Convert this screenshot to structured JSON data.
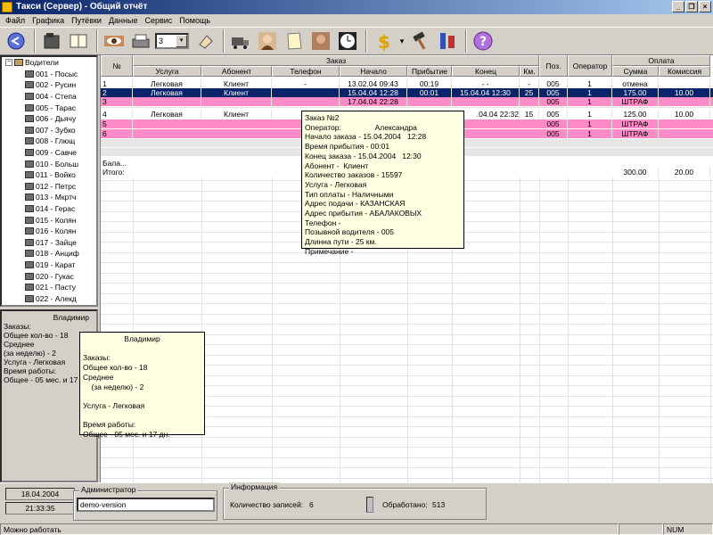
{
  "window": {
    "title": "Такси (Сервер) - Общий отчёт",
    "min": "_",
    "restore": "❐",
    "close": "×"
  },
  "menu": [
    "Файл",
    "Графика",
    "Путёвки",
    "Данные",
    "Сервис",
    "Помощь"
  ],
  "toolbar": {
    "combo_value": "3",
    "combo_arrow": "▾",
    "dropdown_arrow": "▾"
  },
  "tree": {
    "items": [
      "Водители",
      "001 - Посыс",
      "002 - Русин",
      "004 - Степа",
      "005 - Тарас",
      "006 - Дьячу",
      "007 - Зубко",
      "008 - Глющ",
      "009 - Савче",
      "010 - Больш",
      "011 - Войко",
      "012 - Петрс",
      "013 - Мкртч",
      "014 - Герас",
      "015 - Колян",
      "016 - Колян",
      "017 - Зайце",
      "018 - Анциф",
      "019 - Карат",
      "020 - Гукас",
      "021 - Пасту",
      "022 - Алекд"
    ]
  },
  "driver_panel": {
    "lines": [
      "Владимир",
      "",
      "Заказы:",
      "Общее кол-во - 18",
      "Среднее",
      "  (за неделю) - 2",
      "",
      "Услуга - Легковая",
      "",
      "Время работы:",
      "Общее - 05 мес. и 17"
    ]
  },
  "driver_tooltip": {
    "lines": [
      "Владимир",
      "",
      "Заказы:",
      "Общее кол-во - 18",
      "Среднее",
      "    (за неделю) - 2",
      "",
      "Услуга - Легковая",
      "",
      "Время работы:",
      "Общее - 05 мес. и 17 дн."
    ]
  },
  "grid": {
    "group_headers": {
      "order": "Заказ",
      "payment": "Оплата"
    },
    "columns": {
      "num": "№",
      "service": "Услуга",
      "client": "Абонент",
      "phone": "Телефон",
      "start": "Начало",
      "arrival": "Прибытие",
      "end": "Конец",
      "km": "Км.",
      "pos": "Поз.",
      "operator": "Оператор",
      "sum": "Сумма",
      "commission": "Комиссия"
    },
    "rows": [
      {
        "num": "1",
        "service": "Легковая",
        "client": "Клиент",
        "phone": "-",
        "start": "13.02.04   09:43",
        "arrival": "00:19",
        "end": "-          -",
        "km": "-",
        "pos": "005",
        "operator": "1",
        "sum": "отмена",
        "commission": ""
      },
      {
        "num": "2",
        "service": "Легковая",
        "client": "Клиент",
        "phone": "",
        "start": "15.04.04   12:28",
        "arrival": "00:01",
        "end": "15.04.04   12:30",
        "km": "25",
        "pos": "005",
        "operator": "1",
        "sum": "175.00",
        "commission": "10.00"
      },
      {
        "num": "3",
        "service": "",
        "client": "",
        "phone": "",
        "start": "17.04.04   22:28",
        "arrival": "",
        "end": "",
        "km": "",
        "pos": "005",
        "operator": "1",
        "sum": "ШТРАФ",
        "commission": ""
      },
      {
        "num": "4",
        "service": "Легковая",
        "client": "Клиент",
        "phone": "",
        "start": "",
        "arrival": "",
        "end": ".04.04   22:32",
        "km": "15",
        "pos": "005",
        "operator": "1",
        "sum": "125.00",
        "commission": "10.00"
      },
      {
        "num": "5",
        "service": "",
        "client": "",
        "phone": "",
        "start": "",
        "arrival": "",
        "end": "",
        "km": "",
        "pos": "005",
        "operator": "1",
        "sum": "ШТРАФ",
        "commission": ""
      },
      {
        "num": "6",
        "service": "",
        "client": "",
        "phone": "",
        "start": "",
        "arrival": "",
        "end": "",
        "km": "",
        "pos": "005",
        "operator": "1",
        "sum": "ШТРАФ",
        "commission": ""
      }
    ],
    "balance_label": "Бала...",
    "total_label": "Итого:",
    "total_sum": "300.00",
    "total_commission": "20.00"
  },
  "order_tooltip": {
    "lines": [
      "Заказ №2",
      "Оператор:                Александра",
      "Начало заказа - 15.04.2004   12:28",
      "Время прибытия - 00:01",
      "Конец заказа - 15.04.2004   12:30",
      "Абонент -  Клиент",
      "Количество заказов - 15597",
      "Услуга - Легковая",
      "Тип оплаты - Наличными",
      "Адрес подачи - КАЗАНСКАЯ",
      "Адрес прибытия - АБАЛАКОВЫХ",
      "Телефон -",
      "Позывной водителя - 005",
      "Длинна пути - 25 км.",
      "Примечание -"
    ]
  },
  "status": {
    "date": "18.04.2004",
    "time": "21:33:35",
    "admin_title": "Администратор",
    "admin_value": "demo-version",
    "info_title": "Информация",
    "records_label": "Количество записей:",
    "records_value": "6",
    "processed_label": "Обработано:",
    "processed_value": "513",
    "statusbar_text": "Можно работать",
    "num_indicator": "NUM"
  },
  "colors": {
    "selected_row": "#0a246a",
    "penalty_row": "#ff8ac8",
    "tooltip_bg": "#ffffe1",
    "title_start": "#0a246a",
    "title_end": "#a6caf0"
  }
}
